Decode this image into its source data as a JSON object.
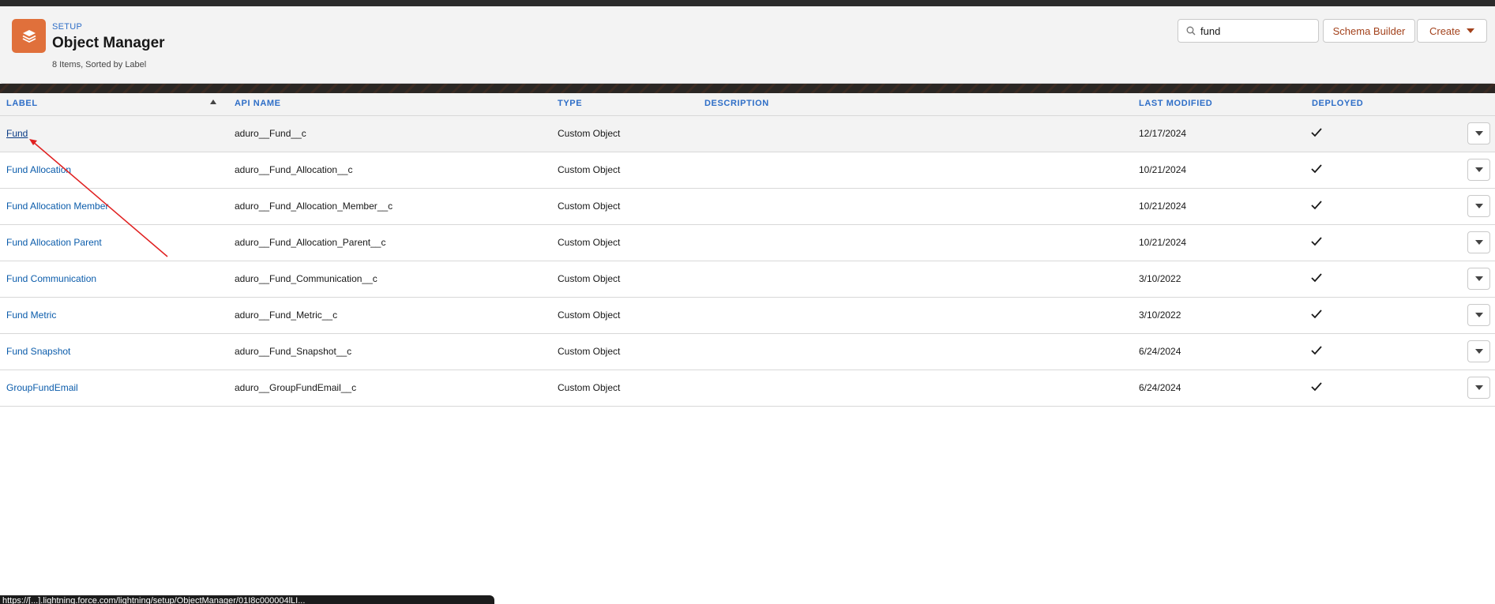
{
  "header": {
    "breadcrumb": "SETUP",
    "title": "Object Manager",
    "count_text": "8 Items, Sorted by Label",
    "app_icon": "layers-icon"
  },
  "search": {
    "value": "fund",
    "icon": "search-icon"
  },
  "toolbar": {
    "schema_builder_label": "Schema Builder",
    "create_label": "Create"
  },
  "table": {
    "columns": [
      "LABEL",
      "API NAME",
      "TYPE",
      "DESCRIPTION",
      "LAST MODIFIED",
      "DEPLOYED"
    ],
    "sort_column": "LABEL",
    "rows": [
      {
        "label": "Fund",
        "api_name": "aduro__Fund__c",
        "type": "Custom Object",
        "description": "",
        "last_modified": "12/17/2024",
        "deployed": true
      },
      {
        "label": "Fund Allocation",
        "api_name": "aduro__Fund_Allocation__c",
        "type": "Custom Object",
        "description": "",
        "last_modified": "10/21/2024",
        "deployed": true
      },
      {
        "label": "Fund Allocation Member",
        "api_name": "aduro__Fund_Allocation_Member__c",
        "type": "Custom Object",
        "description": "",
        "last_modified": "10/21/2024",
        "deployed": true
      },
      {
        "label": "Fund Allocation Parent",
        "api_name": "aduro__Fund_Allocation_Parent__c",
        "type": "Custom Object",
        "description": "",
        "last_modified": "10/21/2024",
        "deployed": true
      },
      {
        "label": "Fund Communication",
        "api_name": "aduro__Fund_Communication__c",
        "type": "Custom Object",
        "description": "",
        "last_modified": "3/10/2022",
        "deployed": true
      },
      {
        "label": "Fund Metric",
        "api_name": "aduro__Fund_Metric__c",
        "type": "Custom Object",
        "description": "",
        "last_modified": "3/10/2022",
        "deployed": true
      },
      {
        "label": "Fund Snapshot",
        "api_name": "aduro__Fund_Snapshot__c",
        "type": "Custom Object",
        "description": "",
        "last_modified": "6/24/2024",
        "deployed": true
      },
      {
        "label": "GroupFundEmail",
        "api_name": "aduro__GroupFundEmail__c",
        "type": "Custom Object",
        "description": "",
        "last_modified": "6/24/2024",
        "deployed": true
      }
    ]
  },
  "status_bar": {
    "text": "https://[...].lightning.force.com/lightning/setup/ObjectManager/01I8c000004lLI..."
  },
  "colors": {
    "accent": "#0b5cab",
    "header_bg": "#f3f3f3",
    "app_icon_bg": "#e0703b",
    "annotation_arrow": "#e02020"
  }
}
